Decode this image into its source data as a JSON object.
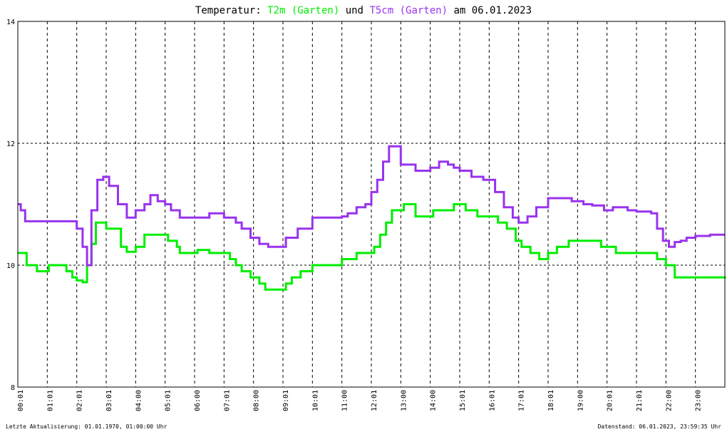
{
  "title": {
    "prefix": "Temperatur:",
    "series1": "T2m (Garten)",
    "connector": "und",
    "series2": "T5cm (Garten)",
    "suffix": "am 06.01.2023"
  },
  "footer": {
    "left": "Letzte Aktualisierung: 01.01.1970, 01:00:00 Uhr",
    "right": "Datenstand: 06.01.2023, 23:59:35 Uhr"
  },
  "colors": {
    "t2m": "#00ee00",
    "t5cm": "#9933ee",
    "grid": "#000000"
  },
  "chart_data": {
    "type": "line",
    "ylim": [
      8,
      14
    ],
    "xlim": [
      0,
      24
    ],
    "grid": true,
    "yticks": [
      "8",
      "10",
      "12",
      "14"
    ],
    "xticks": [
      "00:01",
      "01:01",
      "02:01",
      "03:01",
      "04:00",
      "05:01",
      "06:00",
      "07:01",
      "08:00",
      "09:01",
      "10:01",
      "11:00",
      "12:01",
      "13:00",
      "14:00",
      "15:01",
      "16:01",
      "17:01",
      "18:01",
      "19:00",
      "20:01",
      "21:01",
      "22:00",
      "23:00"
    ],
    "series": [
      {
        "name": "T2m (Garten)",
        "x": [
          0.0,
          0.25,
          0.3,
          0.6,
          0.65,
          1.0,
          1.05,
          1.1,
          1.5,
          1.65,
          1.85,
          2.0,
          2.2,
          2.35,
          2.5,
          2.65,
          2.85,
          3.0,
          3.5,
          3.7,
          4.0,
          4.3,
          5.0,
          5.1,
          5.4,
          5.5,
          6.0,
          6.1,
          6.5,
          7.0,
          7.2,
          7.4,
          7.6,
          7.9,
          8.2,
          8.4,
          8.8,
          9.1,
          9.3,
          9.6,
          10.0,
          11.0,
          11.1,
          11.5,
          11.9,
          12.1,
          12.3,
          12.5,
          12.7,
          13.1,
          13.5,
          13.9,
          14.1,
          14.4,
          14.8,
          15.0,
          15.2,
          15.6,
          16.0,
          16.3,
          16.6,
          16.9,
          17.1,
          17.4,
          17.7,
          18.0,
          18.3,
          18.7,
          19.1,
          19.5,
          19.8,
          20.0,
          20.3,
          21.3,
          21.7,
          22.0,
          22.3,
          23.0,
          24.0
        ],
        "y": [
          10.2,
          10.2,
          10.0,
          10.0,
          9.9,
          9.9,
          10.0,
          10.0,
          10.0,
          9.9,
          9.8,
          9.75,
          9.72,
          10.0,
          10.35,
          10.7,
          10.7,
          10.6,
          10.3,
          10.22,
          10.3,
          10.5,
          10.5,
          10.4,
          10.3,
          10.2,
          10.2,
          10.25,
          10.2,
          10.2,
          10.1,
          10.0,
          9.9,
          9.8,
          9.7,
          9.6,
          9.6,
          9.7,
          9.8,
          9.9,
          10.0,
          10.1,
          10.1,
          10.2,
          10.2,
          10.3,
          10.5,
          10.7,
          10.9,
          11.0,
          10.8,
          10.8,
          10.9,
          10.9,
          11.0,
          11.0,
          10.9,
          10.8,
          10.8,
          10.7,
          10.6,
          10.4,
          10.3,
          10.2,
          10.1,
          10.2,
          10.3,
          10.4,
          10.4,
          10.4,
          10.3,
          10.3,
          10.2,
          10.2,
          10.1,
          10.0,
          9.8,
          9.8,
          9.78
        ]
      },
      {
        "name": "T5cm (Garten)",
        "x": [
          0.0,
          0.1,
          0.25,
          0.6,
          1.0,
          1.5,
          2.0,
          2.2,
          2.35,
          2.5,
          2.7,
          2.9,
          3.1,
          3.4,
          3.7,
          4.0,
          4.3,
          4.5,
          4.75,
          5.0,
          5.2,
          5.5,
          6.0,
          6.5,
          7.0,
          7.2,
          7.4,
          7.6,
          7.9,
          8.2,
          8.5,
          9.0,
          9.1,
          9.5,
          10.0,
          10.5,
          11.0,
          11.2,
          11.5,
          11.8,
          12.0,
          12.2,
          12.4,
          12.6,
          13.0,
          13.5,
          14.0,
          14.3,
          14.6,
          14.8,
          15.0,
          15.4,
          15.8,
          16.0,
          16.2,
          16.5,
          16.8,
          17.0,
          17.3,
          17.6,
          18.0,
          18.4,
          18.8,
          19.2,
          19.5,
          19.9,
          20.2,
          20.7,
          21.0,
          21.5,
          21.7,
          21.9,
          22.1,
          22.3,
          22.5,
          22.7,
          23.0,
          23.5,
          24.0
        ],
        "y": [
          11.0,
          10.9,
          10.72,
          10.72,
          10.72,
          10.72,
          10.6,
          10.3,
          10.0,
          10.9,
          11.4,
          11.45,
          11.3,
          11.0,
          10.78,
          10.9,
          11.0,
          11.15,
          11.05,
          11.0,
          10.9,
          10.78,
          10.78,
          10.85,
          10.78,
          10.78,
          10.7,
          10.6,
          10.45,
          10.35,
          10.3,
          10.3,
          10.45,
          10.6,
          10.78,
          10.78,
          10.8,
          10.85,
          10.95,
          11.0,
          11.2,
          11.4,
          11.7,
          11.95,
          11.65,
          11.55,
          11.6,
          11.7,
          11.65,
          11.6,
          11.55,
          11.45,
          11.4,
          11.4,
          11.2,
          10.95,
          10.78,
          10.7,
          10.8,
          10.95,
          11.1,
          11.1,
          11.05,
          11.0,
          10.98,
          10.9,
          10.95,
          10.9,
          10.88,
          10.85,
          10.6,
          10.4,
          10.3,
          10.38,
          10.4,
          10.45,
          10.48,
          10.5,
          10.5
        ]
      }
    ]
  }
}
